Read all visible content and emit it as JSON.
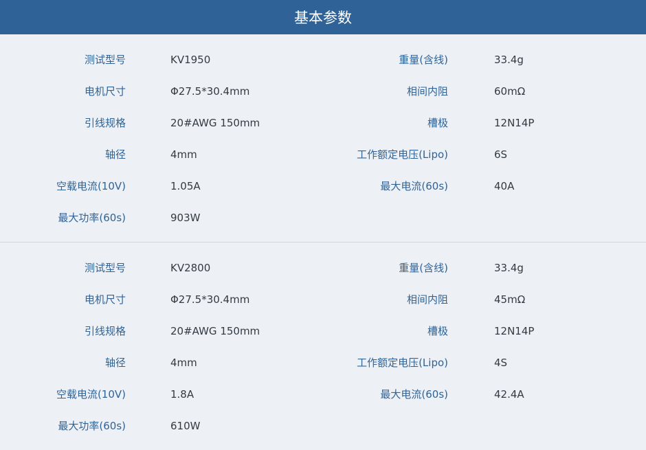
{
  "header": {
    "title": "基本参数"
  },
  "sections": [
    {
      "rows": [
        {
          "left_label": "测试型号",
          "left_value": "KV1950",
          "right_label": "重量(含线)",
          "right_value": "33.4g"
        },
        {
          "left_label": "电机尺寸",
          "left_value": "Φ27.5*30.4mm",
          "right_label": "相间内阻",
          "right_value": "60mΩ"
        },
        {
          "left_label": "引线规格",
          "left_value": "20#AWG 150mm",
          "right_label": "槽极",
          "right_value": "12N14P"
        },
        {
          "left_label": "轴径",
          "left_value": "4mm",
          "right_label": "工作额定电压(Lipo)",
          "right_value": "6S"
        },
        {
          "left_label": "空载电流(10V)",
          "left_value": "1.05A",
          "right_label": "最大电流(60s)",
          "right_value": "40A"
        },
        {
          "left_label": "最大功率(60s)",
          "left_value": "903W"
        }
      ]
    },
    {
      "rows": [
        {
          "left_label": "测试型号",
          "left_value": "KV2800",
          "right_label": "重量(含线)",
          "right_value": "33.4g"
        },
        {
          "left_label": "电机尺寸",
          "left_value": "Φ27.5*30.4mm",
          "right_label": "相间内阻",
          "right_value": "45mΩ"
        },
        {
          "left_label": "引线规格",
          "left_value": "20#AWG 150mm",
          "right_label": "槽极",
          "right_value": "12N14P"
        },
        {
          "left_label": "轴径",
          "left_value": "4mm",
          "right_label": "工作额定电压(Lipo)",
          "right_value": "4S"
        },
        {
          "left_label": "空载电流(10V)",
          "left_value": "1.8A",
          "right_label": "最大电流(60s)",
          "right_value": "42.4A"
        },
        {
          "left_label": "最大功率(60s)",
          "left_value": "610W"
        }
      ]
    }
  ]
}
